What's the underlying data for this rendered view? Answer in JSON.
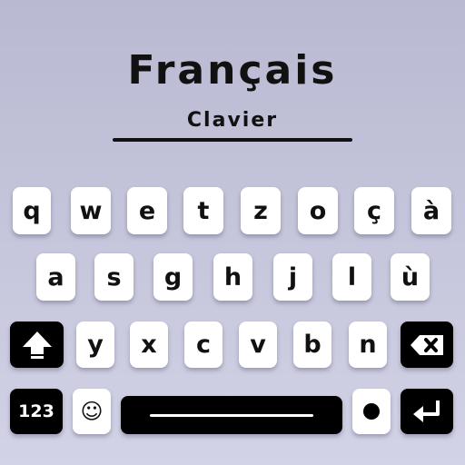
{
  "header": {
    "title": "Français",
    "subtitle": "Clavier"
  },
  "keyboard": {
    "row1": [
      "q",
      "w",
      "e",
      "t",
      "z",
      "o",
      "ç",
      "à"
    ],
    "row2": [
      "a",
      "s",
      "g",
      "h",
      "j",
      "l",
      "ù"
    ],
    "row3": [
      "y",
      "x",
      "c",
      "v",
      "b",
      "n"
    ],
    "numbers_label": "123",
    "emoji": "☺"
  }
}
